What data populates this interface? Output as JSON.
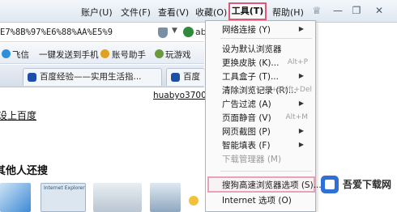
{
  "menubar": {
    "items": [
      "账户(U)",
      "文件(F)",
      "查看(V)",
      "收藏(O)",
      "工具(T)",
      "帮助(H)"
    ],
    "window_controls": [
      "minimize-icon",
      "restore-icon",
      "close-icon"
    ]
  },
  "address": {
    "url": "E7%8B%97%E6%88%AA%E5%9",
    "tail": "ab"
  },
  "favorites": {
    "items": [
      "飞信",
      "一键发送到手机",
      "账号助手",
      "玩游戏"
    ]
  },
  "tabs": {
    "items": [
      "百度经验——实用生活指...",
      "百度"
    ]
  },
  "page": {
    "username": "huabyo3700",
    "link": "设上百度",
    "heading": "其他人还搜",
    "thumb_caption": "Internet Explorer"
  },
  "tools_menu": {
    "items": [
      {
        "label": "网络连接 (Y)",
        "submenu": true
      },
      {
        "label": "设为默认浏览器"
      },
      {
        "label": "更换皮肤 (K)...",
        "shortcut": "Alt+P"
      },
      {
        "label": "工具盒子 (T)...",
        "submenu": true
      },
      {
        "label": "清除浏览记录 (R)...",
        "shortcut": "Ctrl+Shift+Del"
      },
      {
        "label": "广告过滤 (A)",
        "submenu": true
      },
      {
        "label": "页面静音 (V)",
        "shortcut": "Alt+M"
      },
      {
        "label": "网页截图 (P)",
        "submenu": true
      },
      {
        "label": "智能填表 (F)",
        "submenu": true
      },
      {
        "label": "下载管理器 (M)",
        "disabled": true
      },
      {
        "label": "搜狗高速浏览器选项 (S)..."
      },
      {
        "label": "Internet 选项 (O)"
      }
    ]
  },
  "watermark": {
    "text": "吾爱下载网"
  },
  "colors": {
    "highlight_border": "#e0577c",
    "item_highlight": "#e7a3b8",
    "link_text": "#111111"
  }
}
